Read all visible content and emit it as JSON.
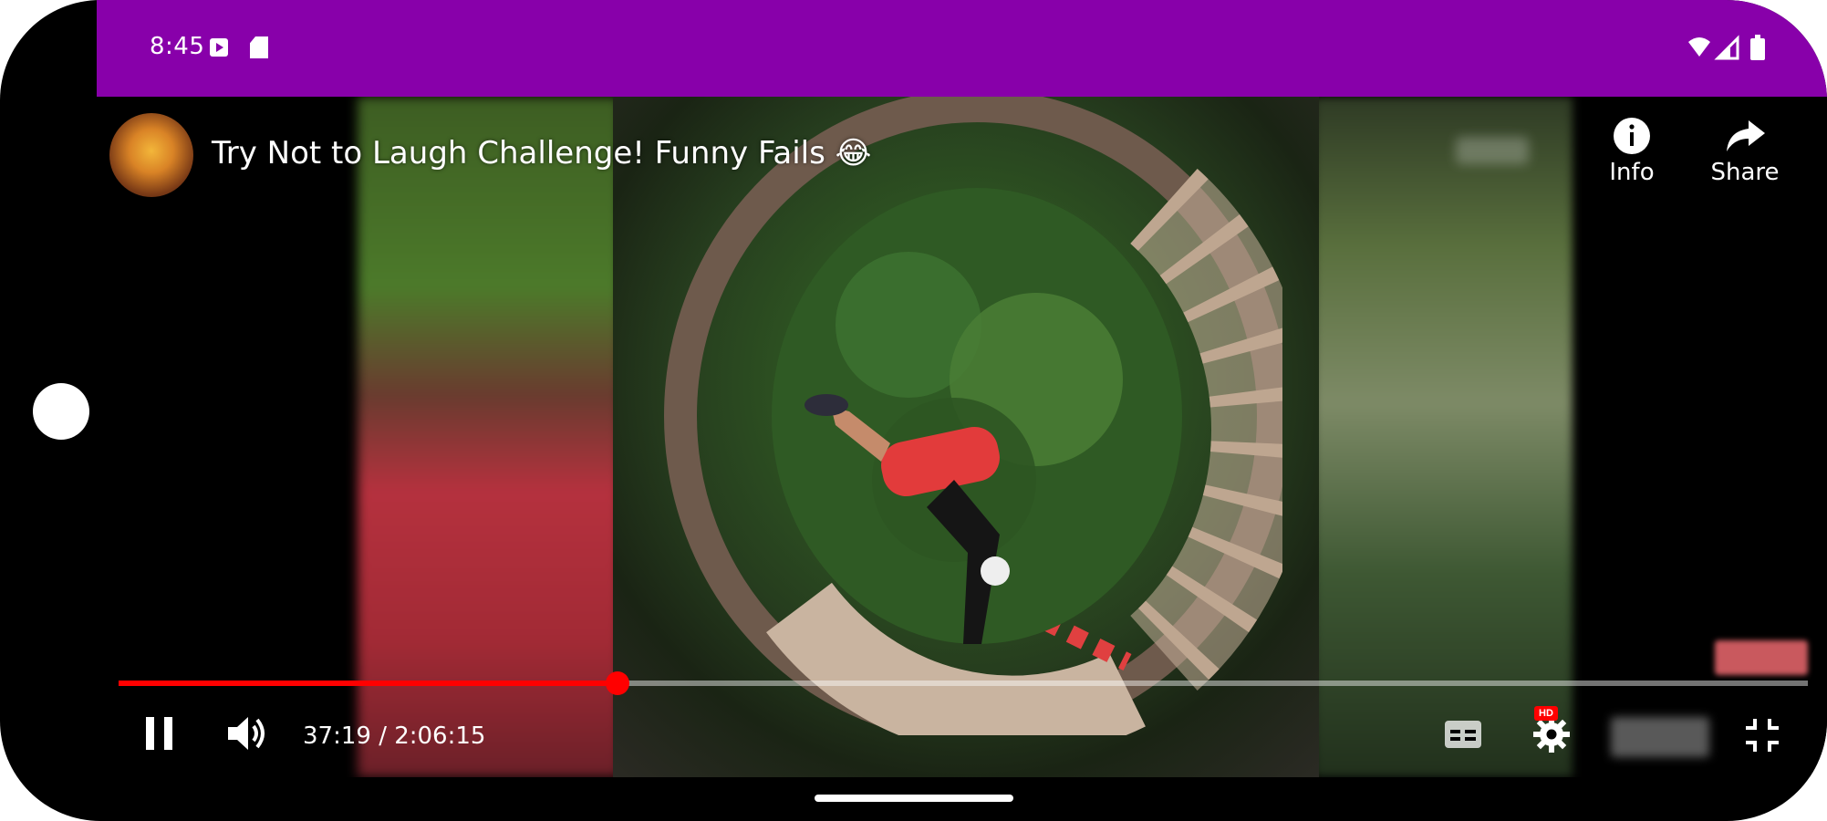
{
  "status_bar": {
    "time": "8:45",
    "icons": [
      "media-icon",
      "sd-card-icon",
      "wifi-icon",
      "signal-icon",
      "battery-icon"
    ],
    "background": "#8800aa"
  },
  "video": {
    "title": "Try Not to Laugh Challenge! Funny Fails 😂",
    "channel_avatar": "channel-avatar",
    "current_time": "37:19",
    "duration": "2:06:15",
    "time_display": "37:19 / 2:06:15",
    "progress_fraction": 0.2955,
    "state": "playing"
  },
  "top_actions": [
    {
      "label": "Info",
      "icon": "info-icon"
    },
    {
      "label": "Share",
      "icon": "share-icon"
    }
  ],
  "controls": {
    "pause_icon": "pause-icon",
    "volume_icon": "volume-icon",
    "captions_icon": "captions-icon",
    "settings_icon": "settings-icon",
    "settings_badge": "HD",
    "fullscreen_exit_icon": "fullscreen-exit-icon"
  },
  "colors": {
    "progress_played": "#ff0000",
    "progress_track": "rgba(255,255,255,0.45)",
    "accent_status": "#8800aa"
  }
}
